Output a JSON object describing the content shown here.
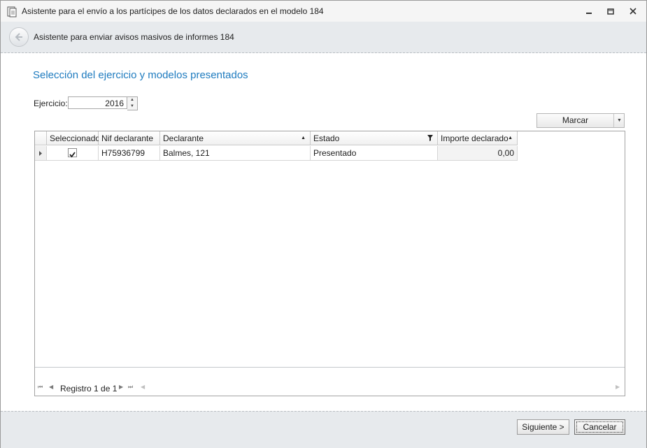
{
  "window": {
    "title": "Asistente para el envío a los partícipes de los datos declarados en el modelo 184",
    "controls": {
      "minimize": "—",
      "restore": "▢",
      "close": "✕"
    }
  },
  "header": {
    "title": "Asistente para enviar avisos masivos de informes 184"
  },
  "section": {
    "title": "Selección del ejercicio y modelos presentados"
  },
  "ejercicio": {
    "label": "Ejercicio:",
    "value": "2016"
  },
  "marcar": {
    "label": "Marcar"
  },
  "grid": {
    "columns": [
      "Seleccionado",
      "Nif declarante",
      "Declarante",
      "Estado",
      "Importe declarado"
    ],
    "rows": [
      {
        "seleccionado": true,
        "nif": "H75936799",
        "declarante": "Balmes, 121",
        "estado": "Presentado",
        "importe": "0,00"
      }
    ],
    "navigator": {
      "text": "Registro 1 de 1"
    }
  },
  "footer": {
    "next_label": "Siguiente >",
    "cancel_label": "Cancelar"
  }
}
